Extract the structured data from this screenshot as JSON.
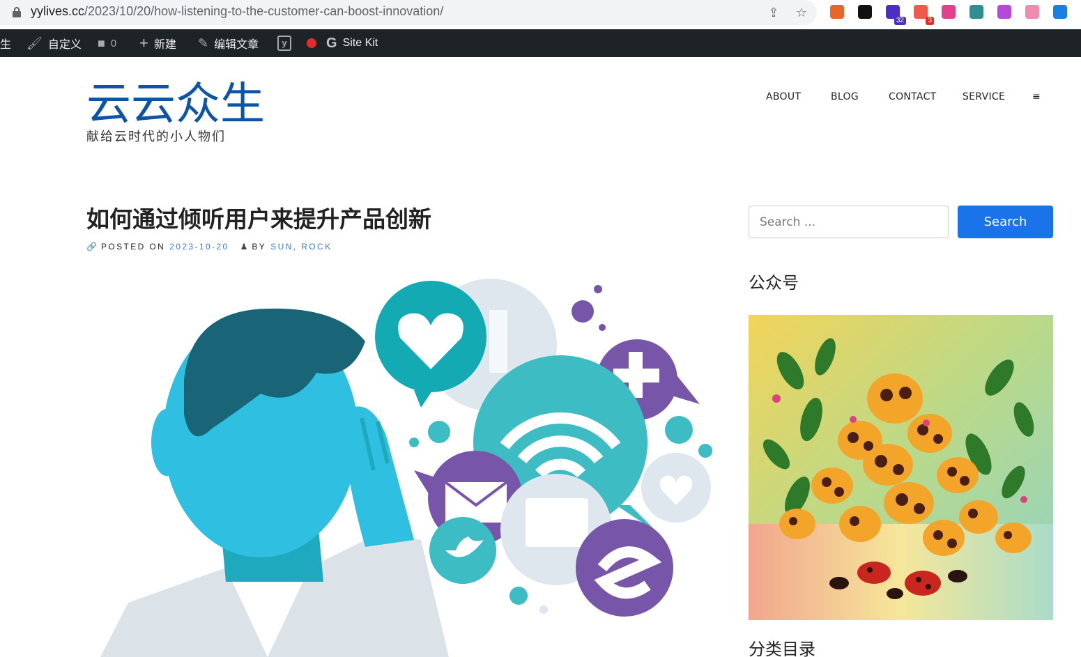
{
  "browser": {
    "url_host": "yylives.cc",
    "url_path": "/2023/10/20/how-listening-to-the-customer-can-boost-innovation/",
    "extensions": [
      {
        "icon": "chrome-ext-icon-1",
        "color": "#e7672a"
      },
      {
        "icon": "notion-icon",
        "color": "#111111"
      },
      {
        "icon": "graduation-cap-icon",
        "color": "#4d2ec4",
        "badge": "32"
      },
      {
        "icon": "red-ext-icon",
        "color": "#f05a4a",
        "badge": "3"
      },
      {
        "icon": "translate-icon",
        "color": "#e2418c"
      },
      {
        "icon": "teal-ext-icon",
        "color": "#2d8f8f"
      },
      {
        "icon": "purple-ext-icon",
        "color": "#b44bd6"
      },
      {
        "icon": "pink-ext-icon",
        "color": "#f08ab0"
      },
      {
        "icon": "blue-ext-icon",
        "color": "#1a7fe0"
      }
    ]
  },
  "adminbar": {
    "site_fragment": "生",
    "customize": "自定义",
    "comments_count": "0",
    "new": "新建",
    "edit_post": "编辑文章",
    "site_kit": "Site Kit"
  },
  "site": {
    "title": "云云众生",
    "tagline": "献给云时代的小人物们",
    "nav": [
      "ABOUT",
      "BLOG",
      "CONTACT",
      "SERVICE",
      "≡"
    ]
  },
  "post": {
    "title": "如何通过倾听用户来提升产品创新",
    "posted_on_label": "POSTED ON",
    "date": "2023-10-20",
    "by_label": "BY",
    "author": "SUN, ROCK"
  },
  "sidebar": {
    "search_placeholder": "Search ...",
    "search_button": "Search",
    "widget_1_title": "公众号",
    "widget_2_title": "分类目录"
  },
  "colors": {
    "site_title": "#0c54a6",
    "admin_bar": "#1d2327",
    "search_button": "#1a73e8",
    "link": "#3a7bd5"
  }
}
